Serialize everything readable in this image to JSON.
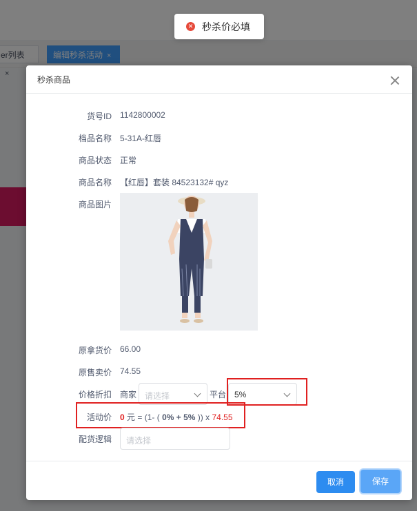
{
  "toast": {
    "message": "秒杀价必填",
    "icon": "error-circle-icon",
    "icon_color": "#e64a3b"
  },
  "background": {
    "tabs": [
      {
        "label": "er列表",
        "close": "×"
      },
      {
        "label": "编辑秒杀活动",
        "close": "×"
      }
    ]
  },
  "dialog": {
    "title": "秒杀商品",
    "fields": {
      "sku_id": {
        "label": "货号ID",
        "value": "1142800002"
      },
      "archive_name": {
        "label": "档品名称",
        "value": "5-31A-红唇"
      },
      "status": {
        "label": "商品状态",
        "value": "正常"
      },
      "product_name": {
        "label": "商品名称",
        "value": "【红唇】套装 84523132# qyz"
      },
      "product_image": {
        "label": "商品图片"
      },
      "orig_cost": {
        "label": "原拿货价",
        "value": "66.00"
      },
      "orig_sale": {
        "label": "原售卖价",
        "value": "74.55"
      },
      "discount": {
        "label": "价格折扣",
        "merchant_label": "商家",
        "merchant_placeholder": "请选择",
        "platform_label": "平台",
        "platform_value": "5%"
      },
      "activity_price": {
        "label": "活动价",
        "price": "0",
        "unit_eq": "元 = (1- (",
        "merchant_pct": "0%",
        "plus": "+",
        "platform_pct": "5%",
        "close_mult": ")) x",
        "base": "74.55"
      },
      "delivery": {
        "label": "配货逻辑",
        "placeholder": "请选择"
      }
    },
    "buttons": {
      "cancel": "取消",
      "save": "保存"
    }
  },
  "colors": {
    "primary": "#2d8cf0",
    "highlight": "#e02020"
  }
}
